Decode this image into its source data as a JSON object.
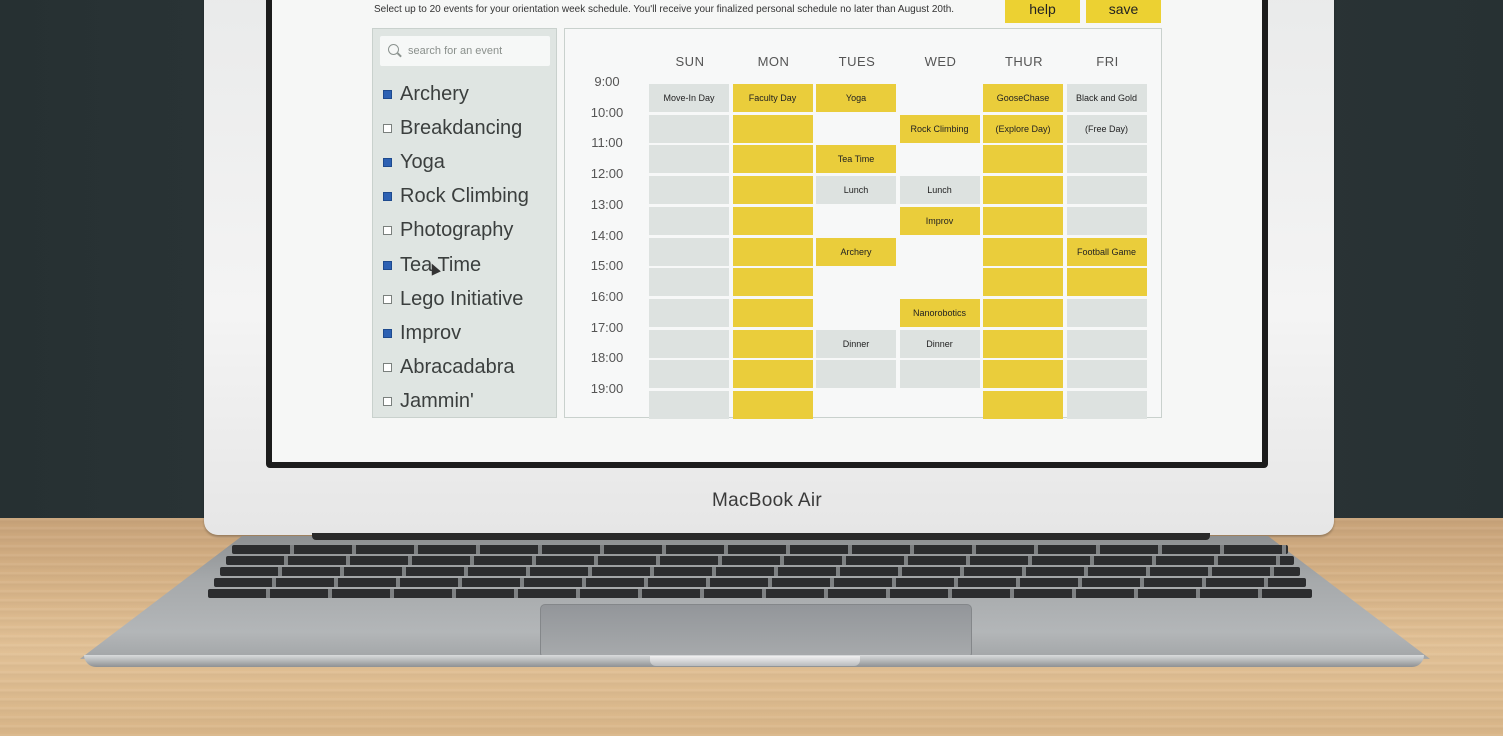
{
  "header": {
    "instructions": "Select up to 20 events for your orientation week schedule. You'll receive your finalized personal schedule no later than August 20th.",
    "help_label": "help",
    "save_label": "save"
  },
  "search": {
    "placeholder": "search for an event",
    "value": ""
  },
  "events": [
    {
      "label": "Archery",
      "checked": true
    },
    {
      "label": "Breakdancing",
      "checked": false
    },
    {
      "label": "Yoga",
      "checked": true
    },
    {
      "label": "Rock Climbing",
      "checked": true
    },
    {
      "label": "Photography",
      "checked": false
    },
    {
      "label": "Tea Time",
      "checked": true
    },
    {
      "label": "Lego Initiative",
      "checked": false
    },
    {
      "label": "Improv",
      "checked": true
    },
    {
      "label": "Abracadabra",
      "checked": false
    },
    {
      "label": "Jammin'",
      "checked": false
    }
  ],
  "calendar": {
    "days": [
      "SUN",
      "MON",
      "TUES",
      "WED",
      "THUR",
      "FRI"
    ],
    "times": [
      "9:00",
      "10:00",
      "11:00",
      "12:00",
      "13:00",
      "14:00",
      "15:00",
      "16:00",
      "17:00",
      "18:00",
      "19:00"
    ],
    "grid": [
      [
        [
          "g",
          "Move-In Day"
        ],
        [
          "y",
          "Faculty Day"
        ],
        [
          "y",
          "Yoga"
        ],
        [
          "w",
          ""
        ],
        [
          "y",
          "GooseChase"
        ],
        [
          "g",
          "Black and Gold"
        ]
      ],
      [
        [
          "g",
          ""
        ],
        [
          "y",
          ""
        ],
        [
          "w",
          ""
        ],
        [
          "y",
          "Rock Climbing"
        ],
        [
          "y",
          "(Explore Day)"
        ],
        [
          "g",
          "(Free Day)"
        ]
      ],
      [
        [
          "g",
          ""
        ],
        [
          "y",
          ""
        ],
        [
          "y",
          "Tea Time"
        ],
        [
          "w",
          ""
        ],
        [
          "y",
          ""
        ],
        [
          "g",
          ""
        ]
      ],
      [
        [
          "g",
          ""
        ],
        [
          "y",
          ""
        ],
        [
          "g",
          "Lunch"
        ],
        [
          "g",
          "Lunch"
        ],
        [
          "y",
          ""
        ],
        [
          "g",
          ""
        ]
      ],
      [
        [
          "g",
          ""
        ],
        [
          "y",
          ""
        ],
        [
          "w",
          ""
        ],
        [
          "y",
          "Improv"
        ],
        [
          "y",
          ""
        ],
        [
          "g",
          ""
        ]
      ],
      [
        [
          "g",
          ""
        ],
        [
          "y",
          ""
        ],
        [
          "y",
          "Archery"
        ],
        [
          "w",
          ""
        ],
        [
          "y",
          ""
        ],
        [
          "y",
          "Football Game"
        ]
      ],
      [
        [
          "g",
          ""
        ],
        [
          "y",
          ""
        ],
        [
          "w",
          ""
        ],
        [
          "w",
          ""
        ],
        [
          "y",
          ""
        ],
        [
          "y",
          ""
        ]
      ],
      [
        [
          "g",
          ""
        ],
        [
          "y",
          ""
        ],
        [
          "w",
          ""
        ],
        [
          "y",
          "Nanorobotics"
        ],
        [
          "y",
          ""
        ],
        [
          "g",
          ""
        ]
      ],
      [
        [
          "g",
          ""
        ],
        [
          "y",
          ""
        ],
        [
          "g",
          "Dinner"
        ],
        [
          "g",
          "Dinner"
        ],
        [
          "y",
          ""
        ],
        [
          "g",
          ""
        ]
      ],
      [
        [
          "g",
          ""
        ],
        [
          "y",
          ""
        ],
        [
          "g",
          ""
        ],
        [
          "g",
          ""
        ],
        [
          "y",
          ""
        ],
        [
          "g",
          ""
        ]
      ],
      [
        [
          "g",
          ""
        ],
        [
          "y",
          ""
        ],
        [
          "w",
          ""
        ],
        [
          "w",
          ""
        ],
        [
          "y",
          ""
        ],
        [
          "g",
          ""
        ]
      ]
    ]
  },
  "device": {
    "brand": "MacBook Air"
  },
  "colors": {
    "accent": "#ecd132",
    "event_selected": "#eacd3b",
    "event_free": "#dde2e0",
    "checkbox_on": "#2d61b3"
  },
  "icons": {
    "search": "search-icon",
    "pointer": "cursor-icon"
  }
}
